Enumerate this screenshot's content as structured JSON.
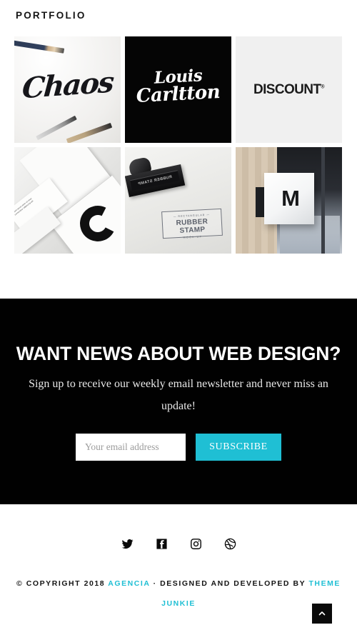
{
  "section": {
    "portfolio_heading": "Portfolio"
  },
  "portfolio": {
    "items": [
      {
        "name": "brush-lettering-sketch",
        "caption": "Chaos",
        "bg_color": "#f3f3f2"
      },
      {
        "name": "louis-carltton-logo",
        "line1": "Louis",
        "line2": "Carltton",
        "bg_color": "#050505"
      },
      {
        "name": "discount-logo",
        "caption": "DISCOUNT",
        "registered_mark": "®",
        "bg_color": "#f0f0f0"
      },
      {
        "name": "stationery-mockup",
        "letter": "C",
        "card_text": "lorem ipsum dolor sit amet consectetur adipiscing elit",
        "bg_color": "#e9e9e7"
      },
      {
        "name": "rubber-stamp-mockup",
        "stamp_label": "RUBBER STAMP",
        "impression_top": "— RECTANGULAR —",
        "impression_main": "RUBBER STAMP",
        "impression_bottom": "MOCK-UP",
        "bg_color": "#eeeeec"
      },
      {
        "name": "storefront-sign-mockup",
        "monogram": "M",
        "bg_color": "#c8b9a6"
      }
    ]
  },
  "newsletter": {
    "title": "WANT NEWS ABOUT WEB DESIGN?",
    "subtitle": "Sign up to receive our weekly email newsletter and never miss an update!",
    "email_placeholder": "Your email address",
    "email_value": "",
    "subscribe_label": "SUBSCRIBE",
    "accent_color": "#1fbfd4",
    "background_color": "#010101"
  },
  "footer": {
    "social": [
      {
        "name": "twitter",
        "label": "Twitter"
      },
      {
        "name": "facebook",
        "label": "Facebook"
      },
      {
        "name": "instagram",
        "label": "Instagram"
      },
      {
        "name": "dribbble",
        "label": "Dribbble"
      }
    ],
    "copyright_prefix": "© Copyright 2018",
    "site_name": "Agencia",
    "separator": "·",
    "credit_text": "Designed and developed by",
    "credit_link": "Theme Junkie",
    "accent_color": "#1fbfd4"
  },
  "scroll_top": {
    "glyph": "chevron-up"
  }
}
